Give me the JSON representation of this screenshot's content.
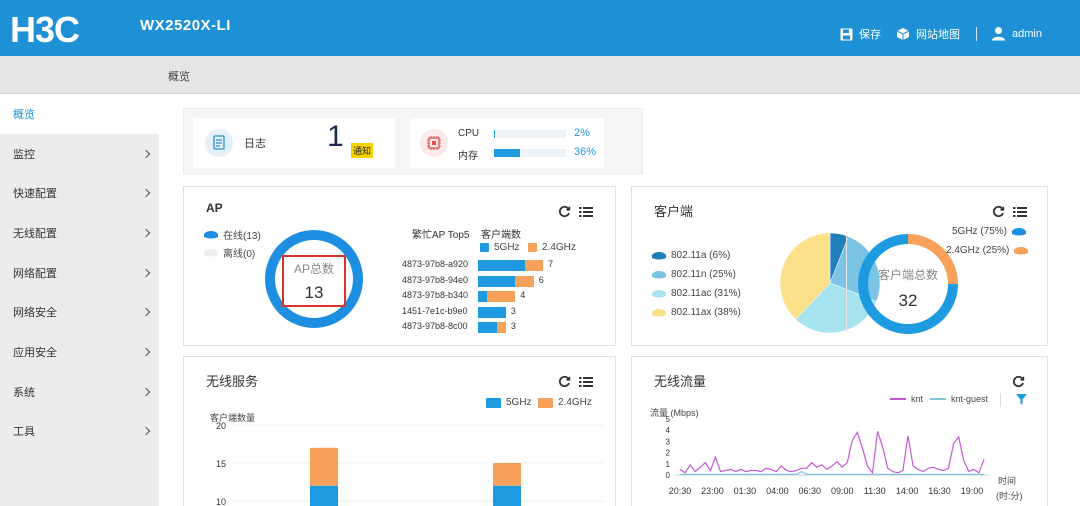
{
  "header": {
    "model": "WX2520X-LI",
    "save_label": "保存",
    "sitemap_label": "网站地图",
    "user_label": "admin",
    "colors": {
      "header_bg": "#1e90d6"
    },
    "logo_text": "H3C"
  },
  "breadcrumb": {
    "current": "概览"
  },
  "sidebar": {
    "items": [
      {
        "label": "概览",
        "active": true
      },
      {
        "label": "监控"
      },
      {
        "label": "快速配置"
      },
      {
        "label": "无线配置"
      },
      {
        "label": "网络配置"
      },
      {
        "label": "网络安全"
      },
      {
        "label": "应用安全"
      },
      {
        "label": "系统"
      },
      {
        "label": "工具"
      }
    ]
  },
  "log_card": {
    "label": "日志",
    "count": "1",
    "badge": "通知"
  },
  "cpu_card": {
    "cpu_label": "CPU",
    "cpu_value": "2%",
    "cpu_percent": 2,
    "mem_label": "内存",
    "mem_value": "36%",
    "mem_percent": 36
  },
  "ap_panel": {
    "title": "AP",
    "online_label": "在线(13)",
    "offline_label": "离线(0)",
    "total_label": "AP总数",
    "total_value": "13",
    "top5_title": "繁忙AP Top5",
    "clients_title": "客户端数",
    "legend_5g": "5GHz",
    "legend_24g": "2.4GHz",
    "top5": [
      {
        "name": "4873-97b8-a920",
        "value": "7",
        "g5": 5,
        "g24": 2
      },
      {
        "name": "4873-97b8-94e0",
        "value": "6",
        "g5": 4,
        "g24": 2
      },
      {
        "name": "4873-97b8-b340",
        "value": "4",
        "g5": 1,
        "g24": 3
      },
      {
        "name": "1451-7e1c-b9e0",
        "value": "3",
        "g5": 3,
        "g24": 0
      },
      {
        "name": "4873-97b8-8c00",
        "value": "3",
        "g5": 2,
        "g24": 1
      }
    ]
  },
  "client_panel": {
    "title": "客户端",
    "modes": [
      {
        "label": "802.11a (6%)",
        "percent": 6,
        "color": "#1f7fb8"
      },
      {
        "label": "802.11n (25%)",
        "percent": 25,
        "color": "#7cc4e6"
      },
      {
        "label": "802.11ac (31%)",
        "percent": 31,
        "color": "#a6e4f0"
      },
      {
        "label": "802.11ax (38%)",
        "percent": 38,
        "color": "#fde08a"
      }
    ],
    "total_label": "客户端总数",
    "total_value": "32",
    "band_5g_label": "5GHz (75%)",
    "band_5g_percent": 75,
    "band_24g_label": "2.4GHz (25%)",
    "band_24g_percent": 25
  },
  "wireless_service": {
    "title": "无线服务",
    "legend_5g": "5GHz",
    "legend_24g": "2.4GHz",
    "chart_data": {
      "type": "bar",
      "ylabel": "客户端数量",
      "yticks": [
        "20",
        "15",
        "10"
      ],
      "ylim_visible": [
        10,
        20
      ],
      "series": [
        {
          "name": "5GHz",
          "values": [
            12,
            12
          ]
        },
        {
          "name": "2.4GHz",
          "values": [
            5,
            3
          ]
        }
      ]
    }
  },
  "wireless_traffic": {
    "title": "无线流量",
    "chart_data": {
      "type": "line",
      "ylabel": "流量 (Mbps)",
      "yticks": [
        "5",
        "4",
        "3",
        "2",
        "1",
        "0"
      ],
      "ylim": [
        0,
        5
      ],
      "xlabel": "时间 (时:分)",
      "xlabel_line1": "时间",
      "xlabel_line2": "(时:分)",
      "xticks": [
        "20:30",
        "23:00",
        "01:30",
        "04:00",
        "06:30",
        "09:00",
        "11:30",
        "14:00",
        "16:30",
        "19:00"
      ],
      "series": [
        {
          "name": "knt",
          "color": "#c45ad1",
          "values": [
            0.5,
            0.2,
            0.9,
            0.3,
            0.7,
            1.1,
            0.4,
            1.6,
            0.3,
            0.4,
            0.5,
            0.3,
            0.5,
            0.3,
            0.4,
            0.4,
            0.3,
            0.6,
            0.5,
            0.3,
            0.8,
            0.4,
            0.3,
            0.4,
            0.6,
            0.6,
            1.1,
            0.7,
            0.9,
            0.5,
            0.8,
            1.2,
            0.7,
            1.1,
            3.1,
            3.8,
            2.4,
            0.8,
            0.2,
            3.9,
            2.5,
            0.6,
            0.3,
            0.2,
            0.4,
            3.5,
            0.8,
            0.5,
            0.3,
            0.6,
            0.7,
            0.5,
            0.4,
            0.6,
            2.8,
            3.4,
            1.3,
            0.3,
            0.5,
            0.2,
            1.4
          ]
        },
        {
          "name": "knt-guest",
          "color": "#7ec6e0",
          "values": [
            0.05,
            0.05,
            0.05,
            0.05,
            0.05,
            0.05,
            0.05,
            0.05,
            0.05,
            0.05,
            0.05,
            0.05,
            0.05,
            0.05,
            0.05,
            0.05,
            0.05,
            0.05,
            0.05,
            0.05,
            0.05,
            0.05,
            0.05,
            0.05,
            0.3,
            0.05,
            0.05,
            0.05,
            0.05,
            0.05,
            0.05,
            0.05,
            0.05,
            0.05,
            0.05,
            0.05,
            0.05,
            0.05,
            0.05,
            0.05,
            0.05,
            0.05,
            0.05,
            0.05,
            0.05,
            0.05,
            0.05,
            0.05,
            0.05,
            0.05,
            0.05,
            0.05,
            0.05,
            0.05,
            0.05,
            0.05,
            0.05,
            0.05,
            0.05,
            0.05,
            0.05
          ]
        }
      ]
    }
  }
}
